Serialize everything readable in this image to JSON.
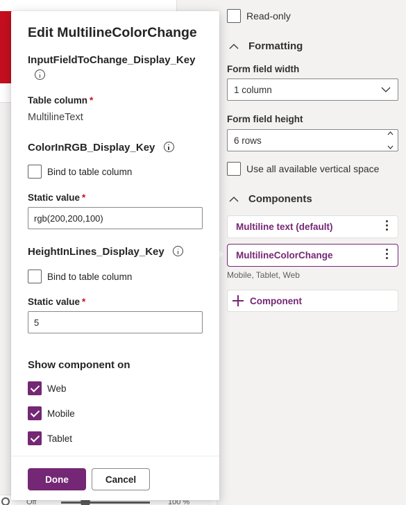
{
  "flyout": {
    "title": "Edit MultilineColorChange",
    "params": [
      {
        "name": "InputFieldToChange_Display_Key",
        "field_label": "Table column",
        "required_mark": "*",
        "value": "MultilineText"
      },
      {
        "name": "ColorInRGB_Display_Key",
        "bind_label": "Bind to table column",
        "bind_checked": false,
        "field_label": "Static value",
        "required_mark": "*",
        "value": "rgb(200,200,100)"
      },
      {
        "name": "HeightInLines_Display_Key",
        "bind_label": "Bind to table column",
        "bind_checked": false,
        "field_label": "Static value",
        "required_mark": "*",
        "value": "5"
      }
    ],
    "show_on": {
      "heading": "Show component on",
      "options": [
        {
          "label": "Web",
          "checked": true
        },
        {
          "label": "Mobile",
          "checked": true
        },
        {
          "label": "Tablet",
          "checked": true
        }
      ]
    },
    "done_label": "Done",
    "cancel_label": "Cancel"
  },
  "properties": {
    "read_only_label": "Read-only",
    "read_only_checked": false,
    "formatting_heading": "Formatting",
    "width_label": "Form field width",
    "width_value": "1 column",
    "height_label": "Form field height",
    "height_value": "6 rows",
    "vertical_space_label": "Use all available vertical space",
    "vertical_space_checked": false,
    "components_heading": "Components",
    "components": [
      {
        "label": "Multiline text (default)",
        "selected": false
      },
      {
        "label": "MultilineColorChange",
        "selected": true,
        "platforms": "Mobile, Tablet, Web"
      }
    ],
    "add_component_label": "Component"
  },
  "status_bar": {
    "toggle_label": "Off",
    "zoom_value": "100 %"
  },
  "colors": {
    "accent": "#742774",
    "required": "#c50f1f",
    "bg": "#f3f2f1"
  }
}
